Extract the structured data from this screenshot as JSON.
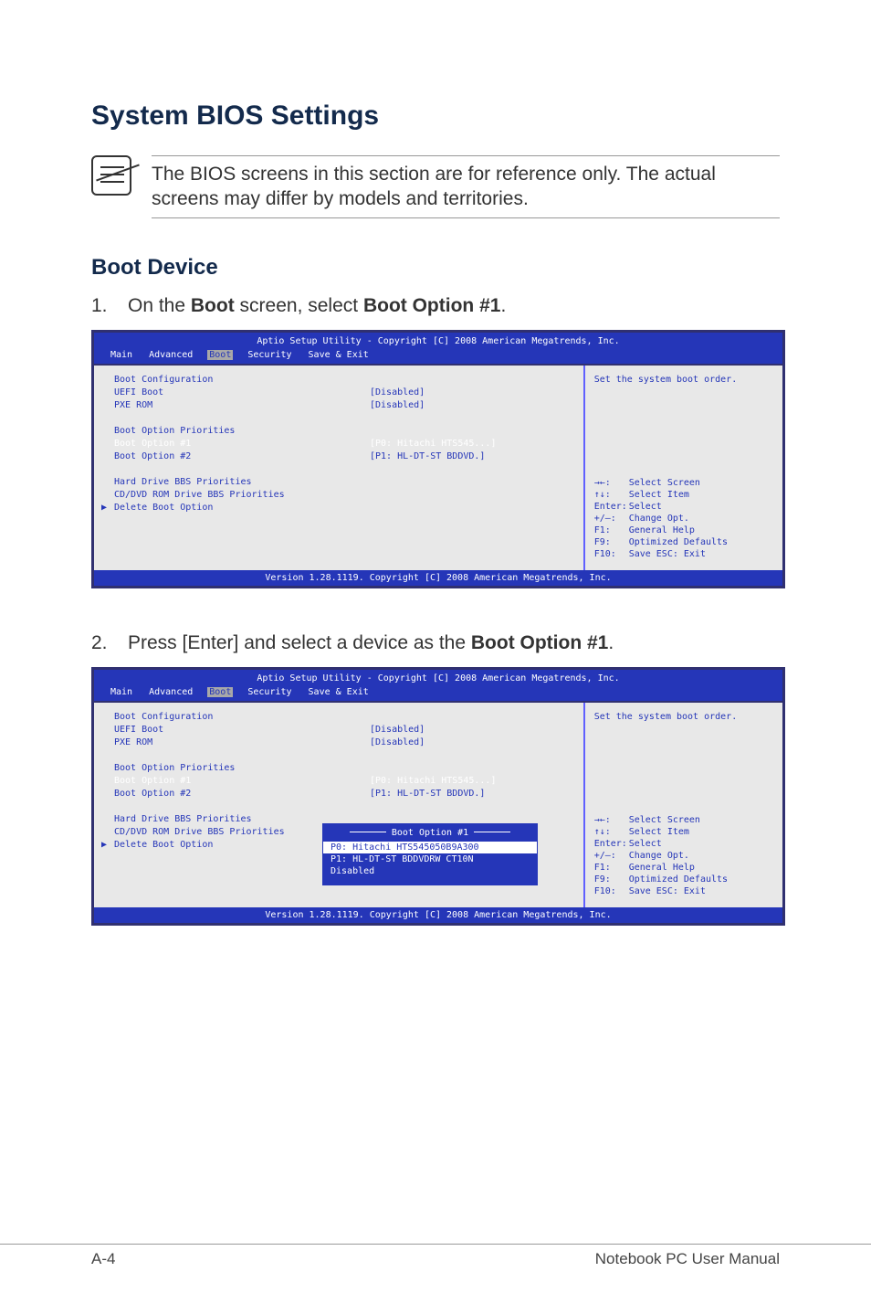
{
  "doc": {
    "h1": "System BIOS Settings",
    "note": "The BIOS screens in this section are for reference only. The actual screens may differ by models and territories.",
    "h2": "Boot Device",
    "step1_num": "1.",
    "step1_pre": "On the ",
    "step1_b1": "Boot",
    "step1_mid": " screen, select ",
    "step1_b2": "Boot Option #1",
    "step1_end": ".",
    "step2_num": "2.",
    "step2_pre": "Press [Enter] and select a device as the ",
    "step2_b1": "Boot Option #1",
    "step2_end": ".",
    "footer_left": "A-4",
    "footer_right": "Notebook PC User Manual"
  },
  "bios": {
    "title": "Aptio Setup Utility - Copyright [C] 2008 American Megatrends, Inc.",
    "menu": [
      "Main",
      "Advanced",
      "Boot",
      "Security",
      "Save & Exit"
    ],
    "selected_menu": 2,
    "footer": "Version 1.28.1119. Copyright [C] 2008 American Megatrends, Inc.",
    "help_text": "Set the system boot order.",
    "left_items": [
      {
        "label": "Boot Configuration"
      },
      {
        "label": "UEFI Boot",
        "value": "[Disabled]"
      },
      {
        "label": "PXE ROM",
        "value": "[Disabled]"
      },
      {
        "label": ""
      },
      {
        "label": "Boot Option Priorities"
      },
      {
        "label": "Boot Option #1",
        "value": "[P0: Hitachi HTS545...]",
        "highlight": true
      },
      {
        "label": "Boot Option #2",
        "value": "[P1: HL-DT-ST BDDVD.]"
      },
      {
        "label": ""
      },
      {
        "label": "Hard Drive BBS Priorities"
      },
      {
        "label": "CD/DVD ROM Drive BBS Priorities"
      },
      {
        "label": "Delete Boot Option",
        "submenu": true
      }
    ],
    "keys": [
      {
        "sym": "→←:",
        "text": "Select Screen"
      },
      {
        "sym": "↑↓:",
        "text": "Select Item"
      },
      {
        "sym": "Enter:",
        "text": "Select"
      },
      {
        "sym": "+/—:",
        "text": "Change Opt."
      },
      {
        "sym": "F1:",
        "text": "General Help"
      },
      {
        "sym": "F9:",
        "text": "Optimized Defaults"
      },
      {
        "sym": "F10:",
        "text": "Save   ESC: Exit"
      }
    ],
    "popup": {
      "title": "Boot Option #1",
      "items": [
        "P0: Hitachi HTS545050B9A300",
        "P1: HL-DT-ST BDDVDRW CT10N",
        "Disabled"
      ],
      "selected": 0
    }
  }
}
